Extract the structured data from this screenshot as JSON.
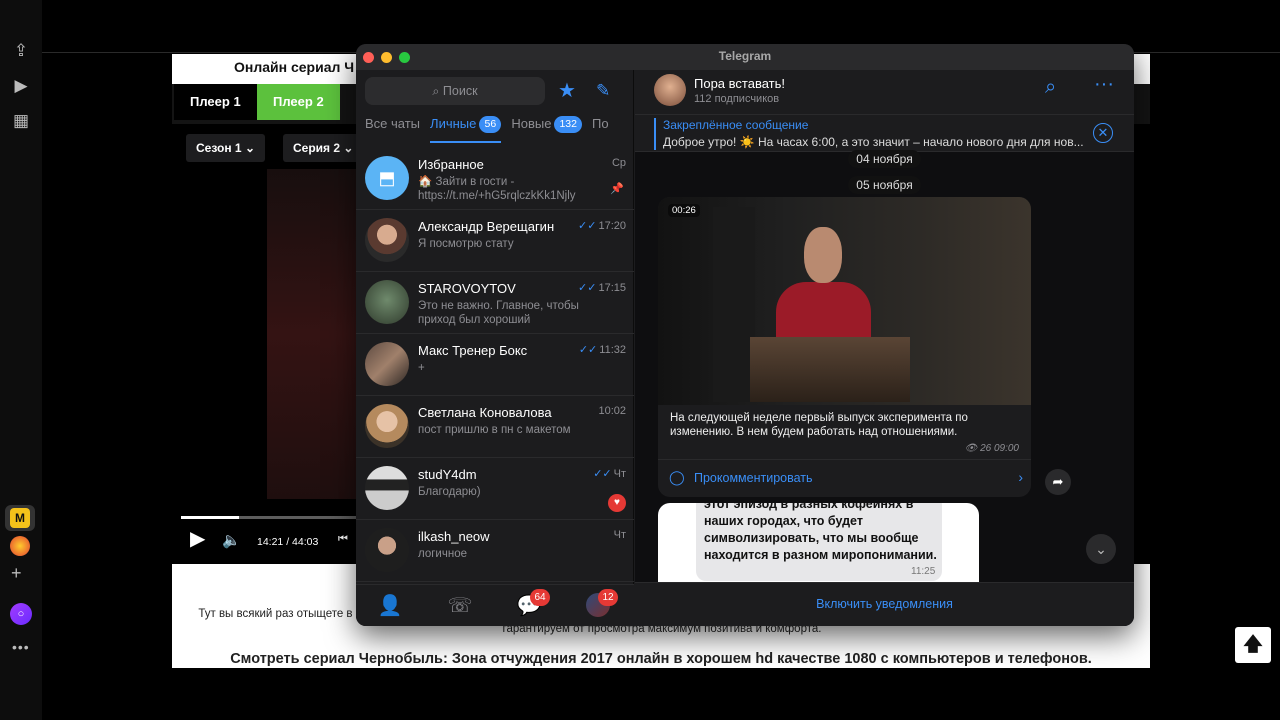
{
  "site": {
    "title": "Онлайн сериал Ч",
    "player1": "Плеер 1",
    "player2": "Плеер 2",
    "season": "Сезон 1",
    "episode": "Серия 2",
    "time": "14:21 / 44:03",
    "progress": 0.33,
    "description": "Тут вы всякий раз отыщете в публикуйте отзывы и комменты и другим легче будет выбрать картину. Наш видеопортал доступен 24/7 на всех устройствах и платформах, мы гарантируем от просмотра максимум позитива и комфорта.",
    "heading": "Смотреть сериал Чернобыль: Зона отчуждения 2017 онлайн в хорошем hd качестве 1080 с компьютеров и телефонов."
  },
  "telegram": {
    "window_title": "Telegram",
    "search_placeholder": "Поиск",
    "tabs": [
      {
        "label": "Все чаты",
        "count": ""
      },
      {
        "label": "Личные",
        "count": "56"
      },
      {
        "label": "Новые",
        "count": "132"
      },
      {
        "label": "По",
        "count": ""
      }
    ],
    "chats": [
      {
        "name": "Избранное",
        "preview": "🏠 Зайти в гости - https://t.me/+hG5rqlczkKk1Njly",
        "time": "Ср",
        "check": ""
      },
      {
        "name": "Александр Верещагин",
        "preview": "Я посмотрю стату",
        "time": "17:20",
        "check": "✓✓"
      },
      {
        "name": "STAROVOYTOV",
        "preview": "Это не важно. Главное, чтобы приход был хороший",
        "time": "17:15",
        "check": "✓✓"
      },
      {
        "name": "Макс Тренер Бокс",
        "preview": "+",
        "time": "11:32",
        "check": "✓✓"
      },
      {
        "name": "Светлана Коновалова",
        "preview": "пост пришлю в пн с макетом",
        "time": "10:02",
        "check": ""
      },
      {
        "name": "studY4dm",
        "preview": "Благодарю)",
        "time": "Чт",
        "check": "✓✓"
      },
      {
        "name": "ilkash_neow",
        "preview": "логичное",
        "time": "Чт",
        "check": ""
      }
    ],
    "bottom_badges": {
      "chats": "64",
      "profile": "12"
    },
    "channel": {
      "name": "Пора вставать!",
      "subscribers": "112 подписчиков",
      "pinned_title": "Закреплённое сообщение",
      "pinned_text": "Доброе утро! ☀️ На часах 6:00, а это значит – начало нового дня для нов...",
      "date1": "04 ноября",
      "date2": "05 ноября",
      "video_time": "00:26",
      "post_text": "На следующей неделе первый выпуск эксперимента по изменению. В нем будем работать над отношениями.",
      "post_meta": "26 09:00",
      "comment": "Прокомментировать",
      "quote_text": "этот эпизод в разных кофейнях в наших городах, что будет символизировать, что мы вообще находится в разном миропонимании.",
      "quote_time": "11:25",
      "notify": "Включить уведомления"
    }
  }
}
